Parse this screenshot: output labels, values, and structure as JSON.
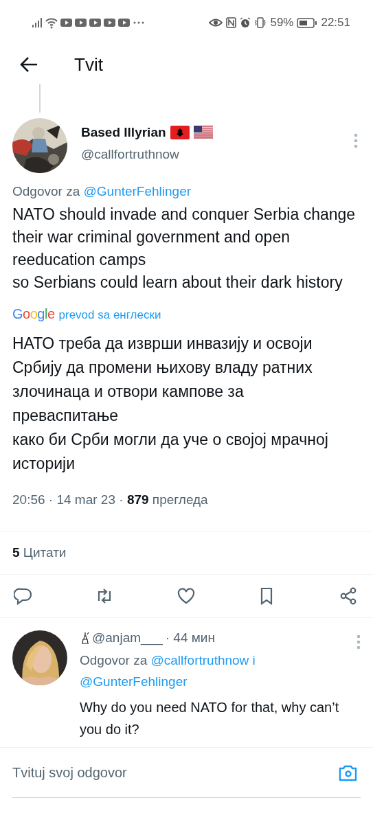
{
  "status_bar": {
    "battery": "59%",
    "time": "22:51"
  },
  "header": {
    "title": "Tvit"
  },
  "tweet": {
    "name": "Based Illyrian",
    "handle": "@callfortruthnow",
    "reply_prefix": "Odgovor za",
    "reply_to": [
      "@GunterFehlinger"
    ],
    "text": "NATO should invade and conquer Serbia change their war criminal government and open reeducation camps\nso Serbians could learn about their dark history",
    "translation_logo": "Google",
    "translation_label": "prevod sa енглески",
    "translated_text": "НАТО треба да изврши инвазију и освоји Србију да промени њихову владу ратних злочинаца и отвори кампове за преваспитање\nкако би Срби могли да уче о својој мрачној историји",
    "time": "20:56 · 14 mar 23 ·",
    "views": "879",
    "views_label": "прегледа",
    "quotes_count": "5",
    "quotes_label": "Цитати",
    "actions": [
      {
        "kind": "reply"
      },
      {
        "kind": "retweet"
      },
      {
        "kind": "like"
      },
      {
        "kind": "bookmark"
      },
      {
        "kind": "share"
      }
    ]
  },
  "replies": [
    {
      "handle": "@anjam___",
      "age": "· 44 мин",
      "reply_prefix": "Odgovor za",
      "reply_to": [
        "@callfortruthnow i",
        "@GunterFehlinger"
      ],
      "text": "Why do you need NATO for that, why can’t you do it?"
    }
  ],
  "compose": {
    "placeholder": "Tvituj svoj odgovor"
  }
}
